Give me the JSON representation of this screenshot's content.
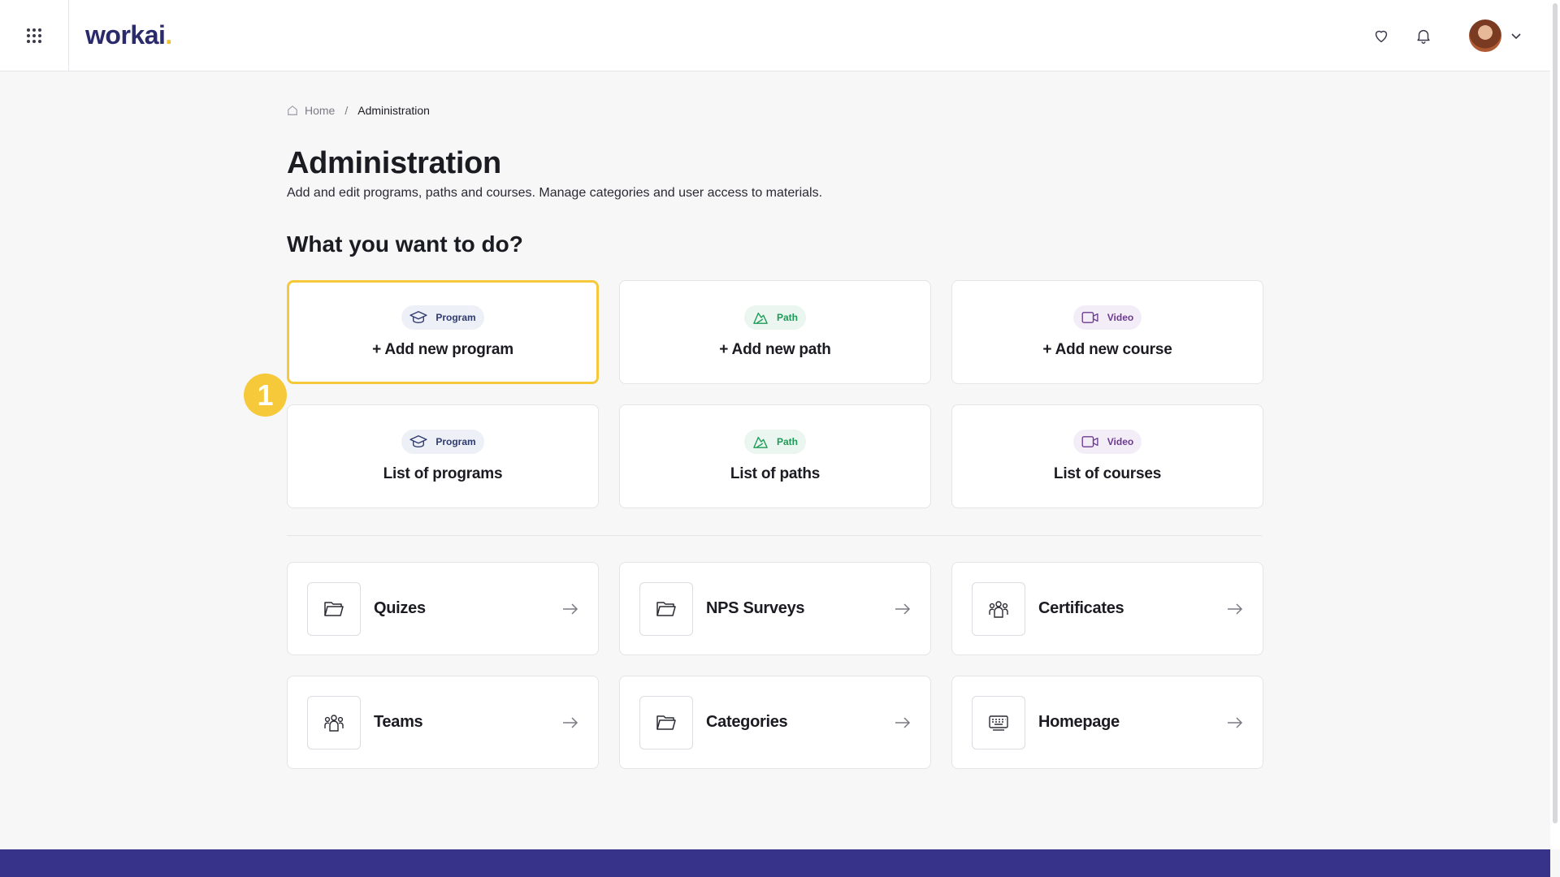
{
  "header": {
    "logo_text": "workai",
    "logo_dot": ".",
    "icons": {
      "apps": "grid-icon",
      "favorites": "heart-icon",
      "notifications": "bell-icon",
      "menu": "chevron-down-icon"
    }
  },
  "breadcrumb": {
    "home_label": "Home",
    "separator": "/",
    "current_label": "Administration"
  },
  "page": {
    "title": "Administration",
    "subtitle": "Add and edit programs, paths and courses. Manage categories and user access to materials.",
    "section_title": "What you want to do?"
  },
  "action_cards": [
    {
      "tag": "Program",
      "label": "+ Add new program",
      "icon": "graduation-cap-icon",
      "highlighted": true
    },
    {
      "tag": "Path",
      "label": "+ Add new path",
      "icon": "path-icon"
    },
    {
      "tag": "Video",
      "label": "+ Add new course",
      "icon": "video-icon"
    },
    {
      "tag": "Program",
      "label": "List of programs",
      "icon": "graduation-cap-icon"
    },
    {
      "tag": "Path",
      "label": "List of paths",
      "icon": "path-icon"
    },
    {
      "tag": "Video",
      "label": "List of courses",
      "icon": "video-icon"
    }
  ],
  "nav_cards": [
    {
      "label": "Quizes",
      "icon": "folder-icon"
    },
    {
      "label": "NPS Surveys",
      "icon": "folder-icon"
    },
    {
      "label": "Certificates",
      "icon": "people-icon"
    },
    {
      "label": "Teams",
      "icon": "people-icon"
    },
    {
      "label": "Categories",
      "icon": "folder-icon"
    },
    {
      "label": "Homepage",
      "icon": "keyboard-icon"
    }
  ],
  "step_badge": "1",
  "colors": {
    "brand_navy": "#2b2a6b",
    "brand_yellow": "#f5c93a",
    "footer": "#38338a",
    "path_green": "#1e9a58",
    "video_purple": "#6b3a91"
  }
}
